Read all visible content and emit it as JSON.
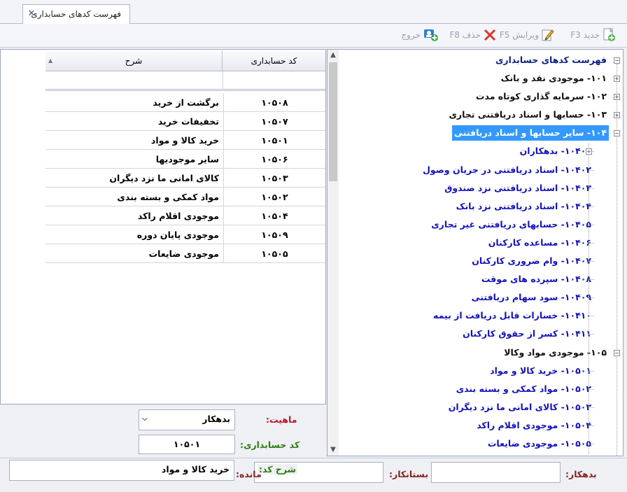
{
  "tab": {
    "title": "فهرست کدهای حسابداری",
    "close_glyph": "✕"
  },
  "toolbar": {
    "new_label": "جدید F3",
    "edit_label": "ویرایش F5",
    "delete_label": "حذف F8",
    "exit_label": "خروج"
  },
  "tree": {
    "root": "فهرست کدهای حسابداری",
    "nodes": [
      {
        "label": "۱۰۱- موجودی نقد و بانک",
        "level": "top"
      },
      {
        "label": "۱۰۲- سرمایه گذاری کوتاه مدت",
        "level": "top"
      },
      {
        "label": "۱۰۳- حسابها و اسناد دریافتنی تجاری",
        "level": "top"
      },
      {
        "label": "۱۰۴- سایر حسابها و اسناد دریافتنی",
        "level": "top",
        "selected": true
      },
      {
        "label": "۱۰۴۰۱- بدهکاران",
        "level": "child"
      },
      {
        "label": "۱۰۴۰۲- اسناد دریافتنی در جریان وصول",
        "level": "child"
      },
      {
        "label": "۱۰۴۰۳- اسناد دریافتنی نزد صندوق",
        "level": "child"
      },
      {
        "label": "۱۰۴۰۴- اسناد دریافتنی نزد بانک",
        "level": "child"
      },
      {
        "label": "۱۰۴۰۵- حسابهای دریافتنی غیر تجاری",
        "level": "child"
      },
      {
        "label": "۱۰۴۰۶- مساعده کارکنان",
        "level": "child"
      },
      {
        "label": "۱۰۴۰۷- وام ضروری کارکنان",
        "level": "child"
      },
      {
        "label": "۱۰۴۰۸- سپرده های موقت",
        "level": "child"
      },
      {
        "label": "۱۰۴۰۹- سود سهام دریافتنی",
        "level": "child"
      },
      {
        "label": "۱۰۴۱۰- خسارات قابل دریافت از بیمه",
        "level": "child"
      },
      {
        "label": "۱۰۴۱۱- کسر از حقوق کارکنان",
        "level": "child"
      },
      {
        "label": "۱۰۵- موجودی مواد وکالا",
        "level": "top"
      },
      {
        "label": "۱۰۵۰۱- خرید کالا و مواد",
        "level": "child"
      },
      {
        "label": "۱۰۵۰۲- مواد کمکی و بسته بندی",
        "level": "child"
      },
      {
        "label": "۱۰۵۰۳- کالای امانی ما نزد دیگران",
        "level": "child"
      },
      {
        "label": "۱۰۵۰۴- موجودی اقلام راکد",
        "level": "child"
      },
      {
        "label": "۱۰۵۰۵- موجودی ضایعات",
        "level": "child"
      }
    ]
  },
  "grid": {
    "col_code": "کد حسابداری",
    "col_desc": "شرح",
    "rows": [
      {
        "code": "۱۰۵۰۸",
        "desc": "برگشت از خرید"
      },
      {
        "code": "۱۰۵۰۷",
        "desc": "تخفیفات خرید"
      },
      {
        "code": "۱۰۵۰۱",
        "desc": "خرید کالا و مواد"
      },
      {
        "code": "۱۰۵۰۶",
        "desc": "سایر موجودیها"
      },
      {
        "code": "۱۰۵۰۳",
        "desc": "کالای امانی ما نزد دیگران"
      },
      {
        "code": "۱۰۵۰۲",
        "desc": "مواد کمکی و بسته بندی"
      },
      {
        "code": "۱۰۵۰۴",
        "desc": "موجودی اقلام راکد"
      },
      {
        "code": "۱۰۵۰۹",
        "desc": "موجودی پایان دوره"
      },
      {
        "code": "۱۰۵۰۵",
        "desc": "موجودی ضایعات"
      }
    ]
  },
  "form": {
    "nature_label": "ماهیت:",
    "nature_value": "بدهکار",
    "code_label": "کد حسابداری:",
    "code_value": "۱۰۵۰۱",
    "desc_label": "شرح کد:",
    "desc_value": "خرید کالا و مواد",
    "balance_label": "مانده:",
    "debit_label": "بدهکار:",
    "debit_value": "",
    "credit_label": "بستانکار:",
    "credit_value": ""
  }
}
